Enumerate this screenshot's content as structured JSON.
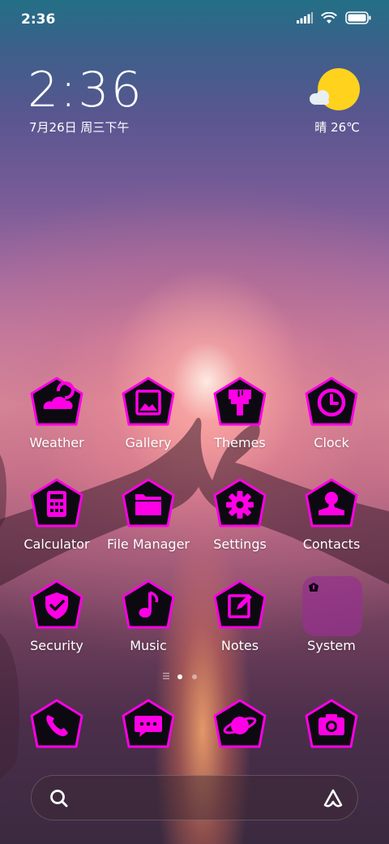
{
  "status_bar": {
    "time": "2:36",
    "icons": [
      "signal-icon",
      "wifi-icon",
      "battery-icon"
    ]
  },
  "clock_widget": {
    "time": "2:36",
    "date": "7月26日 周三下午"
  },
  "weather_widget": {
    "icon": "sunny-cloud-icon",
    "text": "晴 26℃"
  },
  "apps": [
    {
      "label": "Weather",
      "icon": "weather-icon"
    },
    {
      "label": "Gallery",
      "icon": "gallery-icon"
    },
    {
      "label": "Themes",
      "icon": "themes-brush-icon"
    },
    {
      "label": "Clock",
      "icon": "clock-icon"
    },
    {
      "label": "Calculator",
      "icon": "calculator-icon"
    },
    {
      "label": "File Manager",
      "icon": "folder-icon"
    },
    {
      "label": "Settings",
      "icon": "gear-icon"
    },
    {
      "label": "Contacts",
      "icon": "person-icon"
    },
    {
      "label": "Security",
      "icon": "shield-check-icon"
    },
    {
      "label": "Music",
      "icon": "music-note-icon"
    },
    {
      "label": "Notes",
      "icon": "note-edit-icon"
    },
    {
      "label": "System",
      "icon": "folder-system-icon"
    }
  ],
  "dock": [
    {
      "icon": "phone-icon"
    },
    {
      "icon": "message-icon"
    },
    {
      "icon": "browser-planet-icon"
    },
    {
      "icon": "camera-icon"
    }
  ],
  "colors": {
    "icon_accent": "#ff00e6",
    "icon_bg": "#0c0a10",
    "sun": "#ffd21e"
  }
}
